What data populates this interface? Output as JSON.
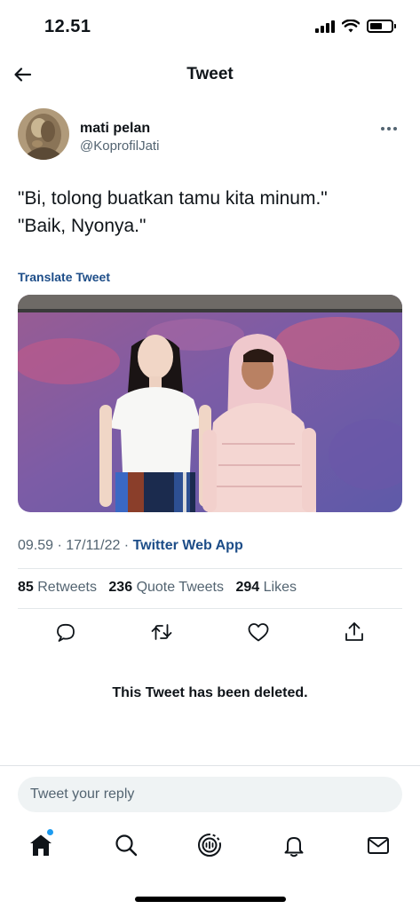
{
  "status_bar": {
    "time": "12.51"
  },
  "nav": {
    "title": "Tweet"
  },
  "author": {
    "display_name": "mati pelan",
    "handle": "@KoprofilJati"
  },
  "tweet": {
    "lines": [
      "\"Bi, tolong buatkan tamu kita minum.\"",
      "\"Baik, Nyonya.\""
    ],
    "translate_label": "Translate Tweet",
    "time": "09.59",
    "date": "17/11/22",
    "source": "Twitter Web App"
  },
  "stats": {
    "retweets_count": "85",
    "retweets_label": "Retweets",
    "quotes_count": "236",
    "quotes_label": "Quote Tweets",
    "likes_count": "294",
    "likes_label": "Likes"
  },
  "deleted_notice": "This Tweet has been deleted.",
  "reply": {
    "placeholder": "Tweet your reply"
  },
  "icons": {
    "back": "arrow-left-icon",
    "more": "more-horizontal-icon",
    "reply": "reply-icon",
    "retweet": "retweet-icon",
    "like": "heart-icon",
    "share": "share-icon",
    "home": "home-icon",
    "search": "search-icon",
    "spaces": "spaces-icon",
    "notifications": "bell-icon",
    "messages": "mail-icon"
  },
  "colors": {
    "link": "#1d4d88",
    "muted": "#536471",
    "text": "#0f1419",
    "accent": "#1d9bf0"
  }
}
